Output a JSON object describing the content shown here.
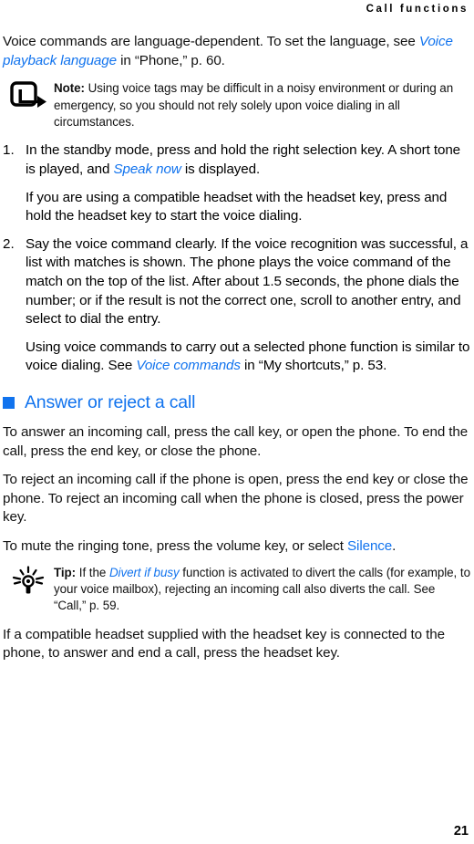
{
  "header": {
    "running_title": "Call functions"
  },
  "colors": {
    "link_blue": "#1173EE",
    "heading_blue": "#1173EE",
    "body_text": "#111111",
    "page_background": "#ffffff"
  },
  "content": {
    "intro_paragraph": {
      "part1": "Voice commands are language-dependent. To set the language, see ",
      "link": "Voice playback language",
      "part2": " in “Phone,” p. 60."
    },
    "note_callout": {
      "icon": "note-arrow-icon",
      "label": "Note:",
      "text": " Using voice tags may be difficult in a noisy environment or during an emergency, so you should not rely solely upon voice dialing in all circumstances."
    },
    "steps": [
      {
        "number": "1.",
        "text_part1": "In the standby mode, press and hold the right selection key. A short tone is played, and ",
        "link": "Speak now",
        "text_part2": " is displayed.",
        "subparagraph": "If you are using a compatible headset with the headset key, press and hold the headset key to start the voice dialing."
      },
      {
        "number": "2.",
        "text_part1": "Say the voice command clearly. If the voice recognition was successful, a list with matches is shown. The phone plays the voice command of the match on the top of the list. After about 1.5 seconds, the phone dials the number; or if the result is not the correct one, scroll to another entry, and select to dial the entry.",
        "link": "",
        "text_part2": "",
        "subparagraph": ""
      }
    ],
    "after_steps_paragraph": {
      "part1": "Using voice commands to carry out a selected phone function is similar to voice dialing. See ",
      "link": "Voice commands",
      "part2": " in “My shortcuts,” p. 53."
    },
    "section_heading": "Answer or reject a call",
    "paragraph_answer": "To answer an incoming call, press the call key, or open the phone. To end the call, press the end key, or close the phone.",
    "paragraph_reject": "To reject an incoming call if the phone is open, press the end key or close the phone. To reject an incoming call when the phone is closed, press the power key.",
    "paragraph_mute": {
      "part1": "To mute the ringing tone, press the volume key, or select ",
      "link": "Silence",
      "part2": "."
    },
    "tip_callout": {
      "icon": "lightbulb-tip-icon",
      "label": "Tip:",
      "text_part1": " If the ",
      "link": "Divert if busy",
      "text_part2": " function is activated to divert the calls (for example, to your voice mailbox), rejecting an incoming call also diverts the call. See “Call,” p. 59."
    },
    "paragraph_headset": "If a compatible headset supplied with the headset key is connected to the phone, to answer and end a call, press the headset key."
  },
  "footer": {
    "page_number": "21"
  }
}
